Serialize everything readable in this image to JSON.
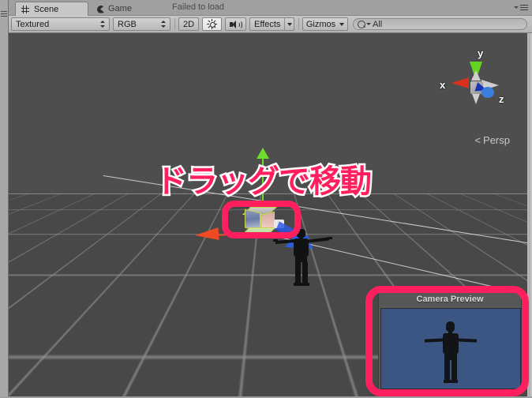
{
  "window": {
    "tabs": [
      {
        "id": "scene",
        "label": "Scene",
        "icon": "grid-icon",
        "active": true
      },
      {
        "id": "game",
        "label": "Game",
        "icon": "game-icon",
        "active": false
      }
    ],
    "status_note": "Failed to load",
    "panel_menu_icon": "panel-menu-icon",
    "rail_menu_icon": "rail-menu-icon"
  },
  "toolbar": {
    "draw_mode": "Textured",
    "color_mode": "RGB",
    "two_d_label": "2D",
    "lighting_icon": "sun-icon",
    "audio_icon": "speaker-icon",
    "effects_label": "Effects",
    "gizmos_label": "Gizmos",
    "search": {
      "value": "All",
      "placeholder": "All",
      "icon": "search-icon"
    }
  },
  "scene": {
    "annotation_text": "ドラッグで移動",
    "annotation_color": "#ff1f5e",
    "highlight_color": "#ff1f5e",
    "background_color": "#4b4b4b",
    "grid_color": "#cdcdcd",
    "selected_object": "main-camera",
    "orientation_gizmo": {
      "x_label": "x",
      "y_label": "y",
      "z_label": "z",
      "x_color": "#d8311c",
      "y_color": "#64d323",
      "z_color": "#3a7fe0",
      "projection_label": "Persp"
    },
    "move_tool": {
      "x_axis_color": "#ef4b22",
      "y_axis_color": "#6ddc2a",
      "z_axis_color": "#2b4fd8"
    }
  },
  "camera_preview": {
    "title": "Camera Preview",
    "background_color": "#3b5682"
  }
}
